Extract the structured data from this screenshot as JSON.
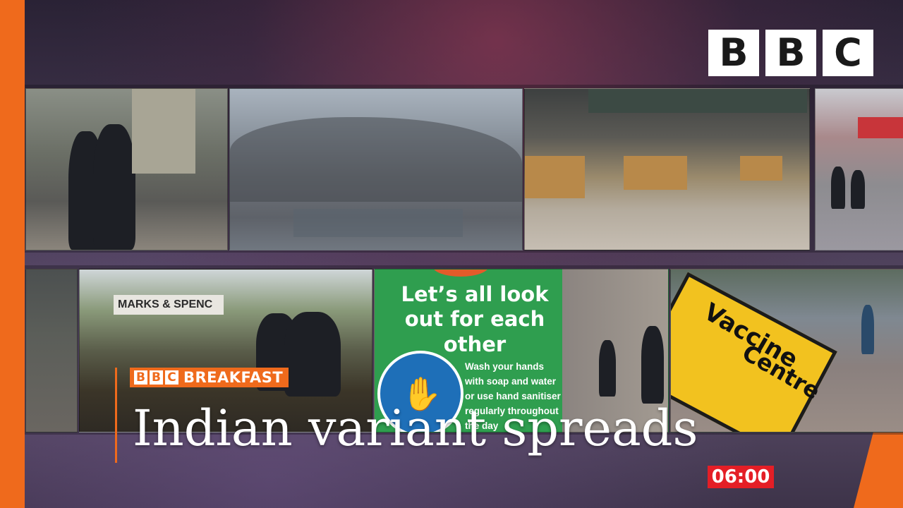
{
  "logo": {
    "letters": [
      "B",
      "B",
      "C"
    ]
  },
  "lower_third": {
    "brand_letters": [
      "B",
      "B",
      "C"
    ],
    "brand_word": "BREAKFAST",
    "headline": "Indian variant spreads",
    "clock": "06:00"
  },
  "tiles": {
    "store_sign": "MARKS & SPENC",
    "poster_title": "Let’s all look out for each other",
    "poster_body": "Wash your hands with soap and water or use hand sanitiser regularly throughout the day",
    "sign_line1": "Vaccine",
    "sign_line2": "Centre"
  },
  "colors": {
    "accent_orange": "#ef6a1c",
    "clock_red": "#e41e26",
    "poster_green": "#2f9e4f"
  }
}
